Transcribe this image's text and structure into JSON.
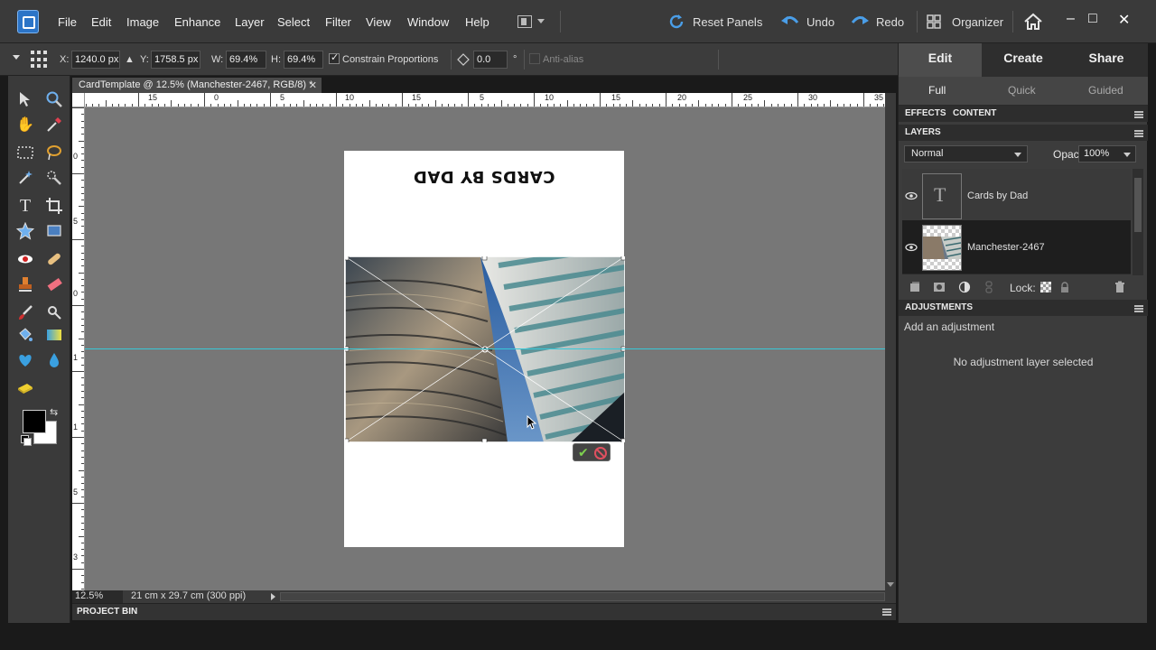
{
  "menu": {
    "items": [
      "File",
      "Edit",
      "Image",
      "Enhance",
      "Layer",
      "Select",
      "Filter",
      "View",
      "Window",
      "Help"
    ],
    "reset_panels": "Reset Panels",
    "undo": "Undo",
    "redo": "Redo",
    "organizer": "Organizer",
    "minimize": "–",
    "maximize": "□",
    "close": "✕"
  },
  "options": {
    "x_label": "X:",
    "x_value": "1240.0 px",
    "y_label": "Y:",
    "y_value": "1758.5 px",
    "w_label": "W:",
    "w_value": "69.4%",
    "h_label": "H:",
    "h_value": "69.4%",
    "constrain_label": "Constrain Proportions",
    "angle_value": "0.0",
    "degree_symbol": "°",
    "antialias_label": "Anti-alias"
  },
  "document": {
    "tab_title": "CardTemplate @ 12.5% (Manchester-2467, RGB/8) *",
    "tab_close": "✕",
    "page_title_text": "CARDS BY DAD",
    "ruler_top_labels": [
      "5",
      "15",
      "0",
      "5",
      "10",
      "15",
      "5",
      "10",
      "15",
      "20",
      "25",
      "30",
      "35"
    ],
    "ruler_left_labels": [
      "0",
      "5",
      "0",
      "1",
      "1",
      "5",
      "3"
    ]
  },
  "status": {
    "zoom": "12.5%",
    "doc_size": "21 cm x 29.7 cm (300 ppi)"
  },
  "project_bin": {
    "title": "PROJECT BIN"
  },
  "panel": {
    "mode_tabs": [
      "Edit",
      "Create",
      "Share"
    ],
    "active_mode": "Edit",
    "sub_tabs": [
      "Full",
      "Quick",
      "Guided"
    ],
    "active_sub": "Full",
    "effects_label": "EFFECTS",
    "content_label": "CONTENT",
    "layers_label": "LAYERS",
    "blend_mode": "Normal",
    "opacity_label": "Opacity:",
    "opacity_value": "100%",
    "layers": [
      {
        "name": "Cards by Dad",
        "type": "text"
      },
      {
        "name": "Manchester-2467",
        "type": "image",
        "selected": true
      }
    ],
    "lock_label": "Lock:",
    "adjustments_label": "ADJUSTMENTS",
    "add_adjustment": "Add an adjustment",
    "no_adjustment": "No adjustment layer selected"
  },
  "colors": {
    "foreground": "#000000",
    "background": "#ffffff",
    "guide": "#37c8d8",
    "accent_blue": "#4a9ee8"
  }
}
